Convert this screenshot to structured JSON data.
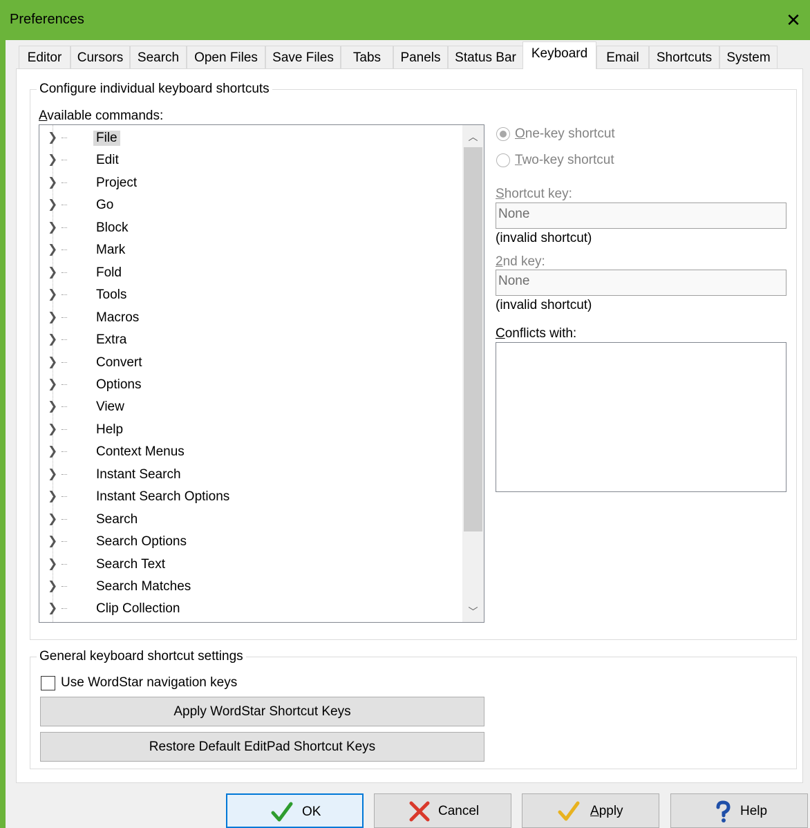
{
  "window": {
    "title": "Preferences",
    "close_glyph": "✕"
  },
  "tabs": [
    {
      "label": "Editor"
    },
    {
      "label": "Cursors"
    },
    {
      "label": "Search"
    },
    {
      "label": "Open Files"
    },
    {
      "label": "Save Files"
    },
    {
      "label": "Tabs"
    },
    {
      "label": "Panels"
    },
    {
      "label": "Status Bar"
    },
    {
      "label": "Keyboard",
      "active": true
    },
    {
      "label": "Email"
    },
    {
      "label": "Shortcuts"
    },
    {
      "label": "System"
    }
  ],
  "configure_group": {
    "title": "Configure individual keyboard shortcuts",
    "available_label_first": "A",
    "available_label_rest": "vailable commands:",
    "commands": [
      "File",
      "Edit",
      "Project",
      "Go",
      "Block",
      "Mark",
      "Fold",
      "Tools",
      "Macros",
      "Extra",
      "Convert",
      "Options",
      "View",
      "Help",
      "Context Menus",
      "Instant Search",
      "Instant Search Options",
      "Search",
      "Search Options",
      "Search Text",
      "Search Matches",
      "Clip Collection"
    ],
    "selected_command": "File",
    "one_key": {
      "first": "O",
      "rest": "ne-key shortcut",
      "checked": true
    },
    "two_key": {
      "first": "T",
      "rest": "wo-key shortcut",
      "checked": false
    },
    "shortcut_key_label": {
      "first": "S",
      "rest": "hortcut key:"
    },
    "shortcut_key_value": "None",
    "shortcut_key_status": "(invalid shortcut)",
    "second_key_label": {
      "first": "2",
      "rest": "nd key:"
    },
    "second_key_value": "None",
    "second_key_status": "(invalid shortcut)",
    "conflicts_label": {
      "first": "C",
      "rest": "onflicts with:"
    }
  },
  "general_group": {
    "title": "General keyboard shortcut settings",
    "wordstar_checkbox": {
      "label": "Use WordStar navigation keys",
      "checked": false
    },
    "apply_wordstar_button": "Apply WordStar Shortcut Keys",
    "restore_default_button": "Restore Default EditPad Shortcut Keys"
  },
  "buttons": {
    "ok": "OK",
    "cancel": "Cancel",
    "apply_first": "A",
    "apply_rest": "pply",
    "help": "Help"
  },
  "colors": {
    "titlebar": "#6bb43a",
    "ok_check": "#2e9c2e",
    "cancel_x": "#d9392b",
    "apply_check": "#e8b21f",
    "help_q": "#1f4fa8"
  }
}
